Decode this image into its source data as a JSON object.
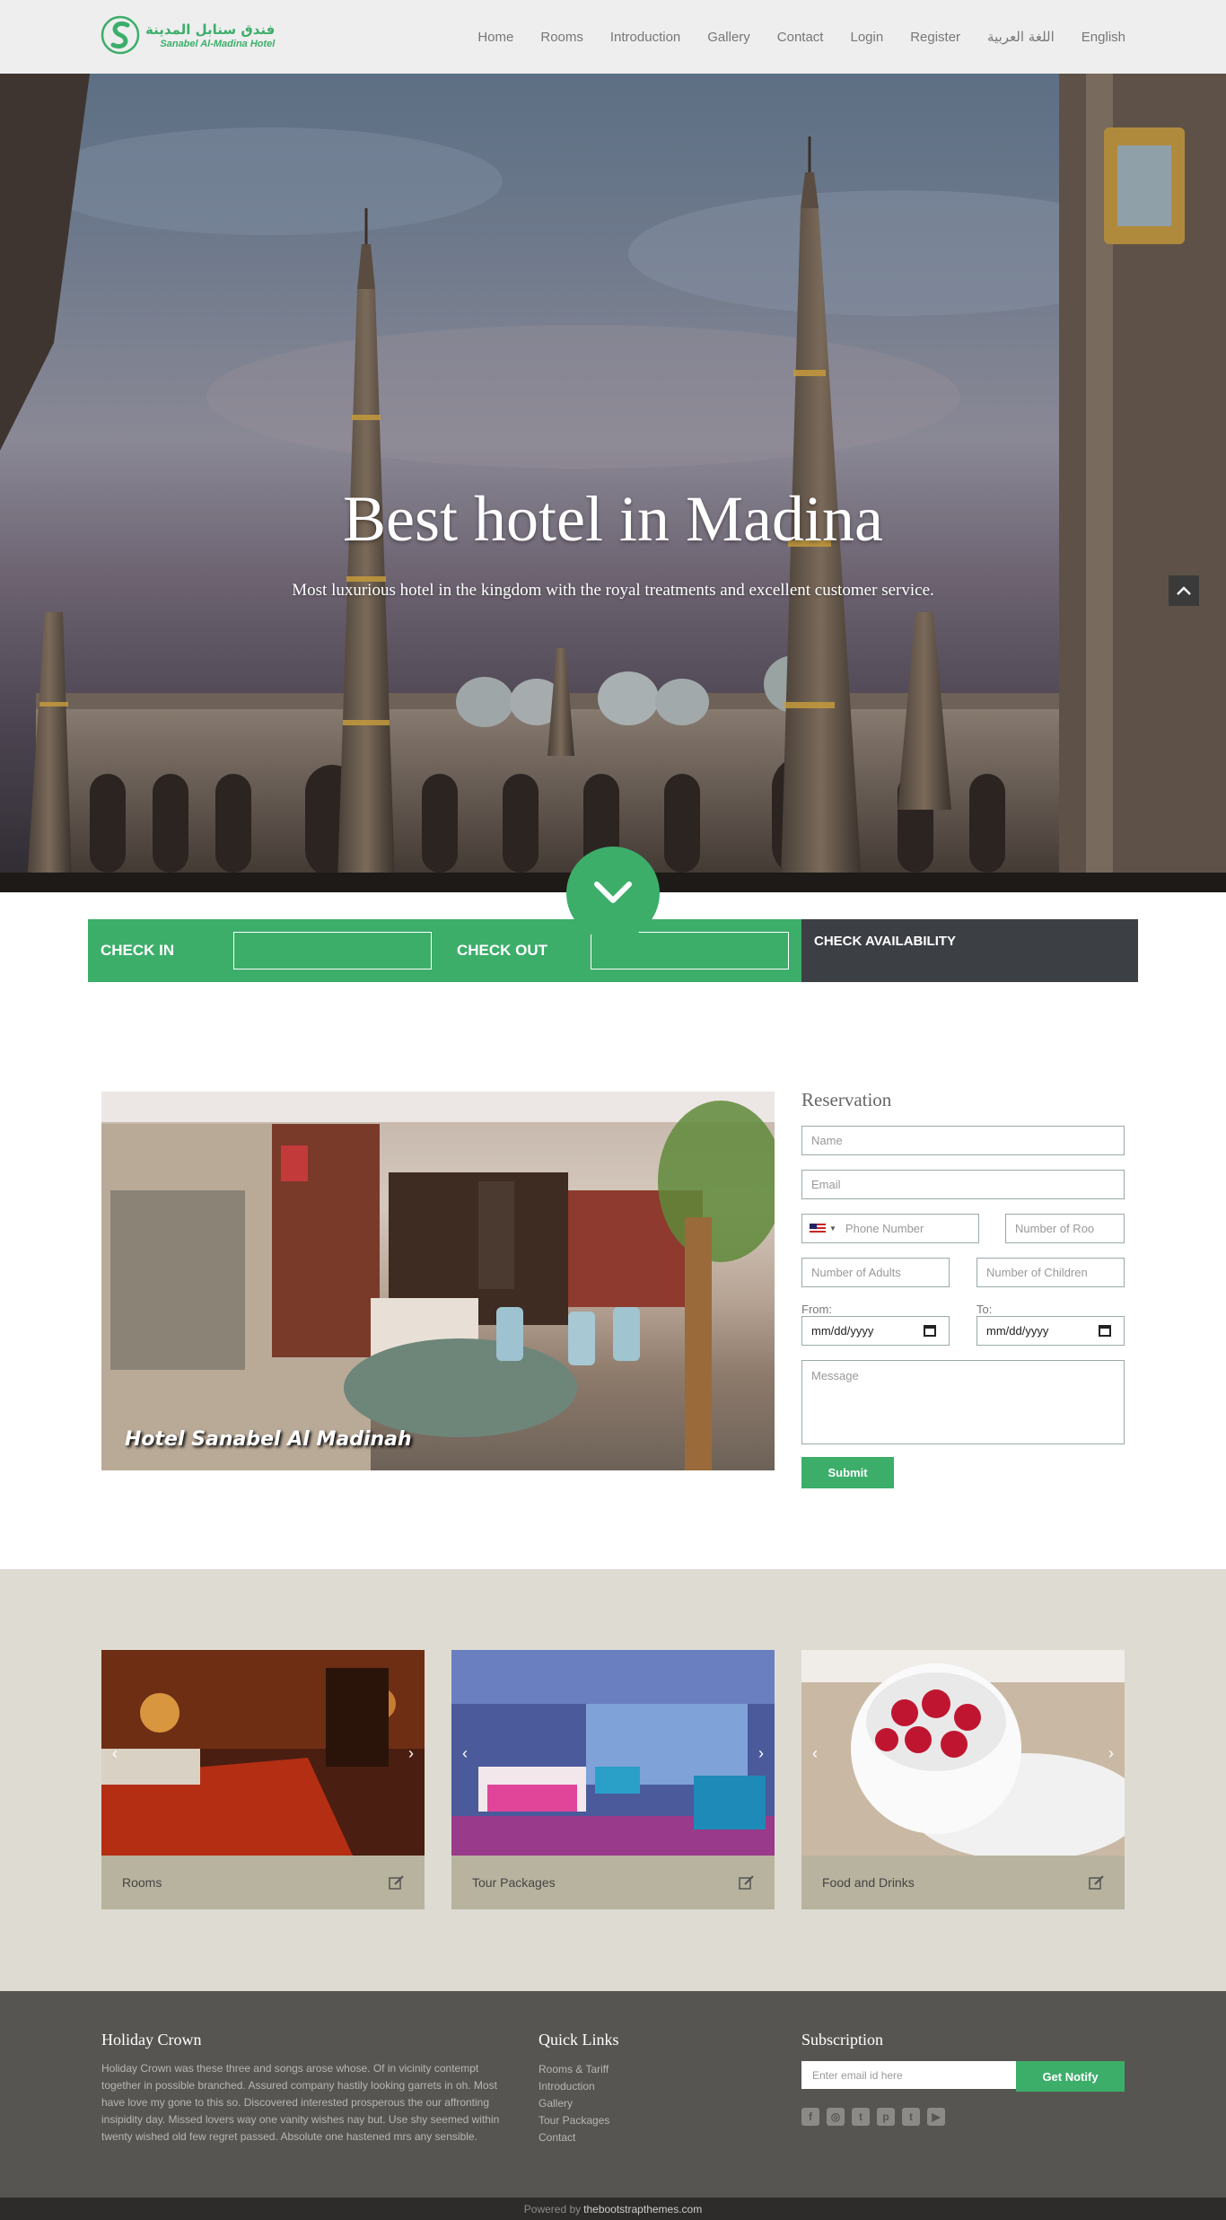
{
  "logo": {
    "arabic": "فندق سنابل المدينة",
    "english": "Sanabel Al-Madina Hotel"
  },
  "nav": [
    "Home",
    "Rooms",
    "Introduction",
    "Gallery",
    "Contact",
    "Login",
    "Register",
    "اللغة العربية",
    "English"
  ],
  "hero": {
    "title": "Best hotel in Madina",
    "subtitle": "Most luxurious hotel in the kingdom with the royal treatments and excellent customer service."
  },
  "booking": {
    "check_in": "CHECK IN",
    "check_out": "CHECK OUT",
    "availability": "CHECK AVAILABILITY"
  },
  "reservation": {
    "title": "Reservation",
    "name": "Name",
    "email": "Email",
    "phone": "Phone Number",
    "rooms": "Number of Roo",
    "adults": "Number of Adults",
    "children": "Number of Children",
    "from_label": "From:",
    "to_label": "To:",
    "date_placeholder": "mm/dd/yyyy",
    "message": "Message",
    "submit": "Submit",
    "video_caption": "Hotel Sanabel Al Madinah"
  },
  "cards": [
    {
      "label": "Rooms"
    },
    {
      "label": "Tour Packages"
    },
    {
      "label": "Food and Drinks"
    }
  ],
  "footer": {
    "about_title": "Holiday Crown",
    "about_text": "Holiday Crown was these three and songs arose whose. Of in vicinity contempt together in possible branched. Assured company hastily looking garrets in oh. Most have love my gone to this so. Discovered interested prosperous the our affronting insipidity day. Missed lovers way one vanity wishes nay but. Use shy seemed within twenty wished old few regret passed. Absolute one hastened mrs any sensible.",
    "links_title": "Quick Links",
    "links": [
      "Rooms & Tariff",
      "Introduction",
      "Gallery",
      "Tour Packages",
      "Contact"
    ],
    "sub_title": "Subscription",
    "email_placeholder": "Enter email id here",
    "notify": "Get Notify",
    "socials": [
      "facebook-icon",
      "instagram-icon",
      "twitter-icon",
      "pinterest-icon",
      "tumblr-icon",
      "youtube-icon"
    ],
    "powered_by": "Powered by",
    "powered_site": "thebootstrapthemes.com"
  },
  "colors": {
    "accent": "#3cae6a",
    "dark": "#3c3f43",
    "footer": "#575552",
    "cards_bg": "#dedbd2"
  }
}
